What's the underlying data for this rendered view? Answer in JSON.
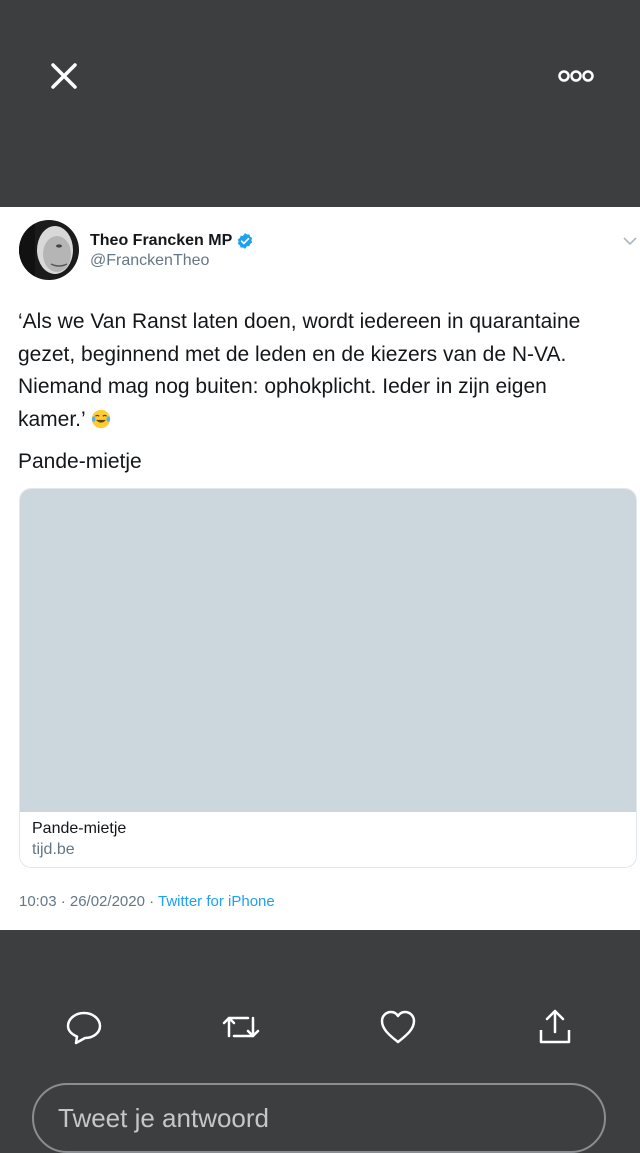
{
  "header": {
    "close_icon": "close-icon",
    "more_icon": "more-dots-icon"
  },
  "tweet": {
    "author_name": "Theo Francken MP",
    "handle": "@FranckenTheo",
    "verified": true,
    "text_lines": [
      "‘Als we Van Ranst laten doen, wordt iedereen in quarantaine",
      "gezet, beginnend met de leden en de kiezers van de N-VA.",
      "Niemand mag nog buiten: ophokplicht. Ieder in zijn eigen",
      "kamer.’"
    ],
    "text_second": "Pande-mietje",
    "emoji": "face-with-tears-of-joy-emoji",
    "card": {
      "title": "Pande-mietje",
      "domain": "tijd.be"
    },
    "timestamp": "10:03 · 26/02/2020 · ",
    "source": "Twitter for iPhone"
  },
  "actions": {
    "reply": "reply-icon",
    "retweet": "retweet-icon",
    "like": "heart-icon",
    "share": "share-icon"
  },
  "reply_input": {
    "placeholder": "Tweet je antwoord"
  },
  "colors": {
    "dark_bg": "#3d3e40",
    "link_blue": "#1da1f2",
    "verified_blue": "#1da1f2",
    "card_image": "#ccd6dd"
  }
}
